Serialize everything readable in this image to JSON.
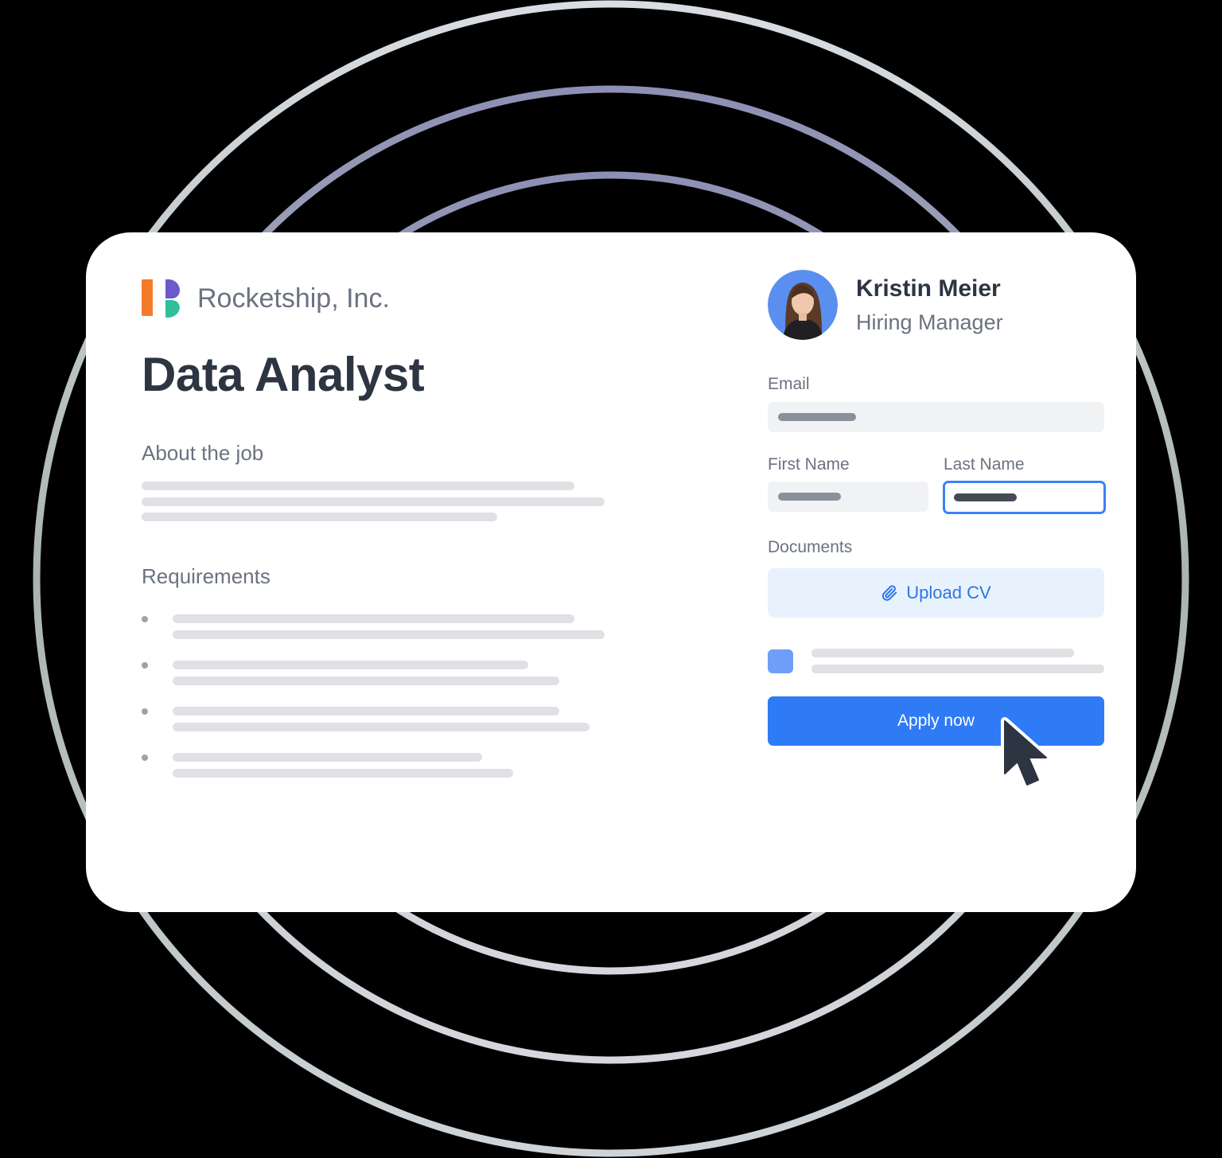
{
  "company": {
    "name": "Rocketship, Inc.",
    "logo_icon": "rocketship-logo-icon"
  },
  "job": {
    "title": "Data Analyst",
    "about_heading": "About the job",
    "requirements_heading": "Requirements"
  },
  "manager": {
    "name": "Kristin Meier",
    "role": "Hiring Manager",
    "avatar_icon": "avatar-photo"
  },
  "form": {
    "email_label": "Email",
    "first_name_label": "First Name",
    "last_name_label": "Last Name",
    "documents_label": "Documents",
    "upload_label": "Upload CV",
    "upload_icon": "paperclip-icon",
    "apply_label": "Apply now"
  },
  "colors": {
    "primary": "#2f7bf6",
    "upload_bg": "#e8f2fd",
    "checkbox": "#6e9ef7",
    "text_dark": "#2d3542",
    "text_muted": "#6b7280",
    "logo_orange": "#f47b2a",
    "logo_purple": "#6a5acd",
    "logo_teal": "#2fbf9b"
  },
  "pointer": {
    "icon": "mouse-pointer-icon"
  }
}
